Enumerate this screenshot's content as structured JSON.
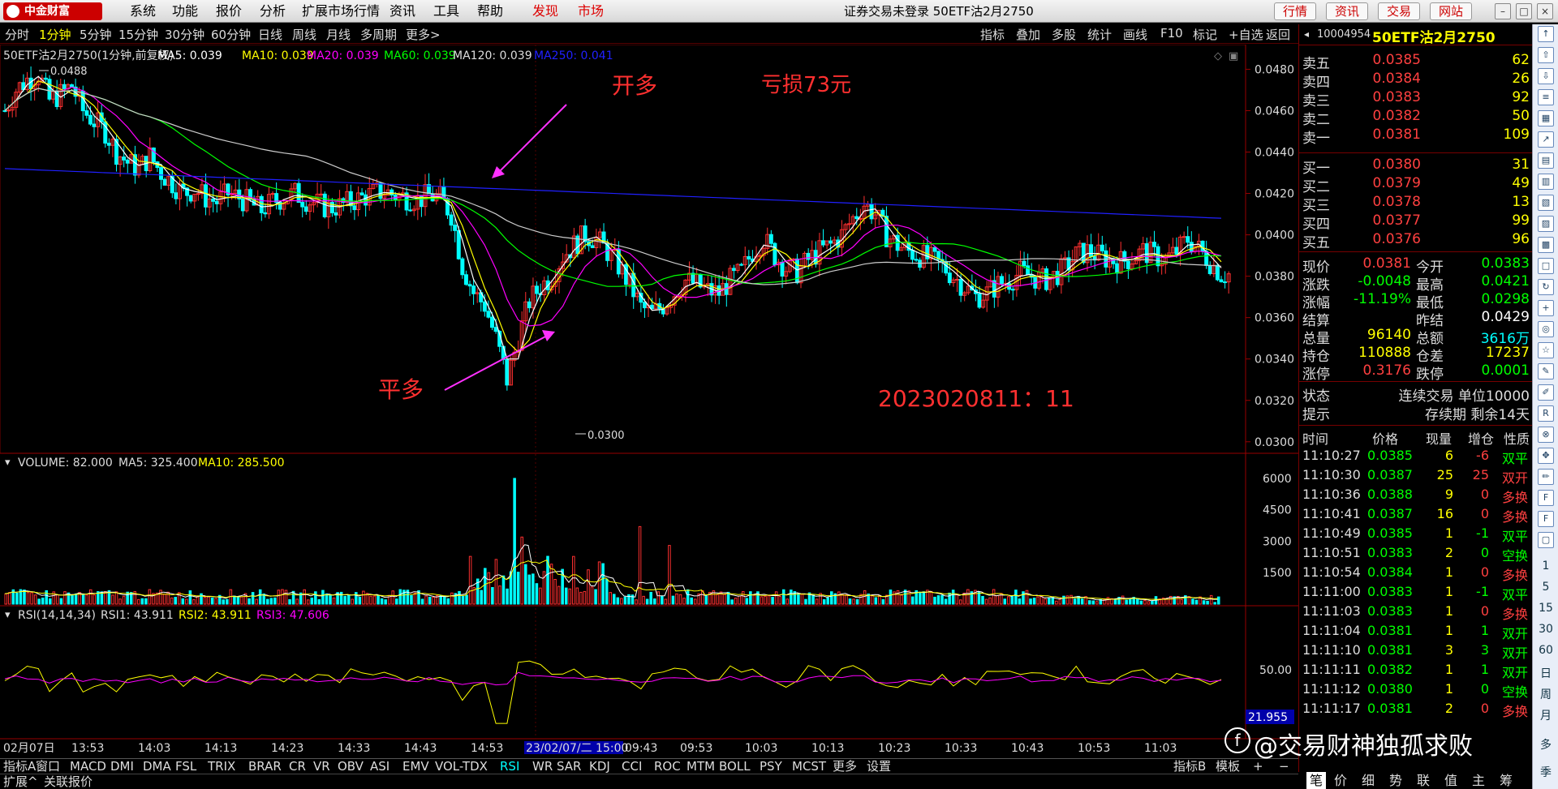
{
  "titlebar": {
    "logo_text": "中金财富",
    "menus": [
      "系统",
      "功能",
      "报价",
      "分析",
      "扩展市场行情",
      "资讯",
      "工具",
      "帮助"
    ],
    "menus_red": [
      "发现",
      "市场"
    ],
    "window_title": "证券交易未登录 50ETF沽2月2750",
    "right_buttons": [
      "行情",
      "资讯",
      "交易",
      "网站"
    ]
  },
  "periods": [
    "分时",
    "1分钟",
    "5分钟",
    "15分钟",
    "30分钟",
    "60分钟",
    "日线",
    "周线",
    "月线",
    "多周期",
    "更多>"
  ],
  "active_period": "1分钟",
  "tools": [
    "指标",
    "叠加",
    "多股",
    "统计",
    "画线",
    "F10",
    "标记",
    "+自选",
    "返回"
  ],
  "main_chart": {
    "header": "50ETF沽2月2750(1分钟,前复权)",
    "ma": [
      {
        "label": "MA5: 0.039",
        "color": "#ffffff"
      },
      {
        "label": "MA10: 0.039",
        "color": "#ffff00"
      },
      {
        "label": "MA20: 0.039",
        "color": "#ff00ff"
      },
      {
        "label": "MA60: 0.039",
        "color": "#00ff00"
      },
      {
        "label": "MA120: 0.039",
        "color": "#dddddd"
      },
      {
        "label": "MA250: 0.041",
        "color": "#2020ff"
      }
    ],
    "y_ticks": [
      "0.0480",
      "0.0460",
      "0.0440",
      "0.0420",
      "0.0400",
      "0.0380",
      "0.0360",
      "0.0340",
      "0.0320",
      "0.0300"
    ],
    "high_label": "0.0488",
    "low_label": "0.0300",
    "annotations": {
      "open_long": "开多",
      "loss": "亏损73元",
      "close_long": "平多",
      "timestamp": "2023020811：11"
    }
  },
  "volume_panel": {
    "header": "VOLUME: 82.000",
    "ma5": "MA5: 325.400",
    "ma10": "MA10: 285.500",
    "y_ticks": [
      "6000",
      "4500",
      "3000",
      "1500"
    ]
  },
  "rsi_panel": {
    "header": "RSI(14,14,34)",
    "rsi1": "RSI1: 43.911",
    "rsi2": "RSI2: 43.911",
    "rsi3": "RSI3: 47.606",
    "y_tick": "50.00",
    "value_badge": "21.955"
  },
  "x_axis": [
    "02月07日",
    "13:53",
    "14:03",
    "14:13",
    "14:23",
    "14:33",
    "14:43",
    "14:53",
    "23/02/07/二 15:00",
    "09:43",
    "09:53",
    "10:03",
    "10:13",
    "10:23",
    "10:33",
    "10:43",
    "10:53",
    "11:03"
  ],
  "indicators": [
    "指标A",
    "窗口",
    "MACD",
    "DMI",
    "DMA",
    "FSL",
    "TRIX",
    "BRAR",
    "CR",
    "VR",
    "OBV",
    "ASI",
    "EMV",
    "VOL-TDX",
    "RSI",
    "WR",
    "SAR",
    "KDJ",
    "CCI",
    "ROC",
    "MTM",
    "BOLL",
    "PSY",
    "MCST",
    "更多",
    "设置"
  ],
  "active_indicator": "RSI",
  "indic_right": [
    "指标B",
    "模板"
  ],
  "status_bar": [
    "扩展^",
    "关联报价"
  ],
  "quote": {
    "code": "10004954",
    "name": "50ETF沽2月2750",
    "asks": [
      {
        "label": "卖五",
        "price": "0.0385",
        "vol": "62"
      },
      {
        "label": "卖四",
        "price": "0.0384",
        "vol": "26"
      },
      {
        "label": "卖三",
        "price": "0.0383",
        "vol": "92"
      },
      {
        "label": "卖二",
        "price": "0.0382",
        "vol": "50"
      },
      {
        "label": "卖一",
        "price": "0.0381",
        "vol": "109"
      }
    ],
    "bids": [
      {
        "label": "买一",
        "price": "0.0380",
        "vol": "31"
      },
      {
        "label": "买二",
        "price": "0.0379",
        "vol": "49"
      },
      {
        "label": "买三",
        "price": "0.0378",
        "vol": "13"
      },
      {
        "label": "买四",
        "price": "0.0377",
        "vol": "99"
      },
      {
        "label": "买五",
        "price": "0.0376",
        "vol": "96"
      }
    ],
    "stats": [
      {
        "l1": "现价",
        "v1": "0.0381",
        "c1": "#ff4040",
        "l2": "今开",
        "v2": "0.0383",
        "c2": "#00ff00"
      },
      {
        "l1": "涨跌",
        "v1": "-0.0048",
        "c1": "#00ff00",
        "l2": "最高",
        "v2": "0.0421",
        "c2": "#00ff00"
      },
      {
        "l1": "涨幅",
        "v1": "-11.19%",
        "c1": "#00ff00",
        "l2": "最低",
        "v2": "0.0298",
        "c2": "#00ff00"
      },
      {
        "l1": "结算",
        "v1": "",
        "c1": "#ffffff",
        "l2": "昨结",
        "v2": "0.0429",
        "c2": "#ffffff"
      },
      {
        "l1": "总量",
        "v1": "96140",
        "c1": "#ffff00",
        "l2": "总额",
        "v2": "3616万",
        "c2": "#00ffff"
      },
      {
        "l1": "持仓",
        "v1": "110888",
        "c1": "#ffff00",
        "l2": "仓差",
        "v2": "17237",
        "c2": "#ffff00"
      },
      {
        "l1": "涨停",
        "v1": "0.3176",
        "c1": "#ff4040",
        "l2": "跌停",
        "v2": "0.0001",
        "c2": "#00ff00"
      }
    ],
    "state_label": "状态",
    "state_value": "连续交易 单位10000",
    "tip_label": "提示",
    "tip_value": "存续期 剩余14天",
    "trade_headers": [
      "时间",
      "价格",
      "现量",
      "增仓",
      "性质"
    ],
    "trades": [
      {
        "t": "11:10:27",
        "p": "0.0385",
        "v": "6",
        "d": "-6",
        "n": "双平",
        "nc": "#00ff00",
        "dc": "#ff4040"
      },
      {
        "t": "11:10:30",
        "p": "0.0387",
        "v": "25",
        "d": "25",
        "n": "双开",
        "nc": "#ff4040",
        "dc": "#ff4040"
      },
      {
        "t": "11:10:36",
        "p": "0.0388",
        "v": "9",
        "d": "0",
        "n": "多换",
        "nc": "#ff4040",
        "dc": "#ff4040"
      },
      {
        "t": "11:10:41",
        "p": "0.0387",
        "v": "16",
        "d": "0",
        "n": "多换",
        "nc": "#ff4040",
        "dc": "#ff4040"
      },
      {
        "t": "11:10:49",
        "p": "0.0385",
        "v": "1",
        "d": "-1",
        "n": "双平",
        "nc": "#00ff00",
        "dc": "#00ff00"
      },
      {
        "t": "11:10:51",
        "p": "0.0383",
        "v": "2",
        "d": "0",
        "n": "空换",
        "nc": "#00ff00",
        "dc": "#00ff00"
      },
      {
        "t": "11:10:54",
        "p": "0.0384",
        "v": "1",
        "d": "0",
        "n": "多换",
        "nc": "#ff4040",
        "dc": "#ff4040"
      },
      {
        "t": "11:11:00",
        "p": "0.0383",
        "v": "1",
        "d": "-1",
        "n": "双平",
        "nc": "#00ff00",
        "dc": "#00ff00"
      },
      {
        "t": "11:11:03",
        "p": "0.0383",
        "v": "1",
        "d": "0",
        "n": "多换",
        "nc": "#ff4040",
        "dc": "#ff4040"
      },
      {
        "t": "11:11:04",
        "p": "0.0381",
        "v": "1",
        "d": "1",
        "n": "双开",
        "nc": "#00ff00",
        "dc": "#00ff00"
      },
      {
        "t": "11:11:10",
        "p": "0.0381",
        "v": "3",
        "d": "3",
        "n": "双开",
        "nc": "#00ff00",
        "dc": "#00ff00"
      },
      {
        "t": "11:11:11",
        "p": "0.0382",
        "v": "1",
        "d": "1",
        "n": "双开",
        "nc": "#00ff00",
        "dc": "#00ff00"
      },
      {
        "t": "11:11:12",
        "p": "0.0380",
        "v": "1",
        "d": "0",
        "n": "空换",
        "nc": "#00ff00",
        "dc": "#00ff00"
      },
      {
        "t": "11:11:17",
        "p": "0.0381",
        "v": "2",
        "d": "0",
        "n": "多换",
        "nc": "#ff4040",
        "dc": "#ff4040"
      }
    ],
    "tabs": [
      "笔",
      "价",
      "细",
      "势",
      "联",
      "值",
      "主",
      "筹"
    ]
  },
  "icon_strip_labels": [
    "1",
    "5",
    "15",
    "30",
    "60",
    "日",
    "周",
    "月",
    "多",
    "季"
  ],
  "watermark": "@交易财神独孤求败",
  "colors": {
    "up": "#ff3030",
    "down": "#00ffff",
    "bg": "#000000",
    "grid": "#700000"
  },
  "chart_data": {
    "type": "candlestick",
    "price_range": [
      0.0296,
      0.0488
    ],
    "high": 0.0488,
    "low": 0.03,
    "last": 0.0381,
    "volume_range": [
      0,
      6500
    ],
    "rsi_range": [
      0,
      100
    ],
    "close_path": [
      0.046,
      0.047,
      0.0475,
      0.0478,
      0.0465,
      0.0468,
      0.0472,
      0.046,
      0.0455,
      0.045,
      0.044,
      0.0435,
      0.0432,
      0.0438,
      0.043,
      0.0425,
      0.042,
      0.0422,
      0.0418,
      0.0416,
      0.042,
      0.0418,
      0.0415,
      0.0412,
      0.0416,
      0.0418,
      0.042,
      0.0417,
      0.0415,
      0.0413,
      0.0414,
      0.0416,
      0.0418,
      0.042,
      0.0421,
      0.0419,
      0.0418,
      0.0417,
      0.0419,
      0.0418,
      0.041,
      0.0385,
      0.0372,
      0.0366,
      0.035,
      0.033,
      0.035,
      0.0368,
      0.0375,
      0.038,
      0.039,
      0.0395,
      0.04,
      0.0398,
      0.0392,
      0.0385,
      0.0376,
      0.0365,
      0.0362,
      0.0366,
      0.0372,
      0.0378,
      0.0376,
      0.0373,
      0.0372,
      0.0378,
      0.0382,
      0.0392,
      0.0398,
      0.039,
      0.0384,
      0.0382,
      0.0388,
      0.0392,
      0.0395,
      0.04,
      0.0408,
      0.0415,
      0.041,
      0.04,
      0.0395,
      0.0392,
      0.039,
      0.0388,
      0.0385,
      0.038,
      0.0375,
      0.037,
      0.0372,
      0.0376,
      0.0378,
      0.0382,
      0.038,
      0.0378,
      0.038,
      0.0384,
      0.039,
      0.0392,
      0.039,
      0.0388,
      0.0387,
      0.0389,
      0.0392,
      0.039,
      0.0388,
      0.0392,
      0.0398,
      0.0393,
      0.0387,
      0.0381
    ]
  }
}
